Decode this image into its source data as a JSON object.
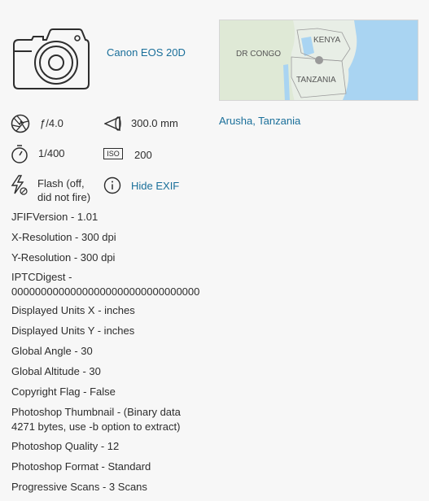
{
  "camera": {
    "icon": "camera-icon",
    "model": "Canon EOS 20D"
  },
  "map": {
    "labels": {
      "country_a": "DR CONGO",
      "country_b": "KENYA",
      "country_c": "TANZANIA"
    },
    "location": "Arusha, Tanzania"
  },
  "stats": {
    "aperture": "ƒ/4.0",
    "focal_length": "300.0 mm",
    "shutter": "1/400",
    "iso_label": "ISO",
    "iso": "200",
    "flash_line1": "Flash (off,",
    "flash_line2": "did not fire)",
    "hide_exif": "Hide EXIF"
  },
  "exif": [
    "JFIFVersion - 1.01",
    "X-Resolution - 300 dpi",
    "Y-Resolution - 300 dpi",
    "IPTCDigest -",
    "00000000000000000000000000000000",
    "Displayed Units X - inches",
    "Displayed Units Y - inches",
    "Global Angle - 30",
    "Global Altitude - 30",
    "Copyright Flag - False",
    "Photoshop Thumbnail - (Binary data",
    "4271 bytes, use -b option to extract)",
    "Photoshop Quality - 12",
    "Photoshop Format - Standard",
    "Progressive Scans - 3 Scans"
  ],
  "colors": {
    "link": "#1a6f9a",
    "water": "#a9d4f2",
    "land": "#e8eee6"
  }
}
